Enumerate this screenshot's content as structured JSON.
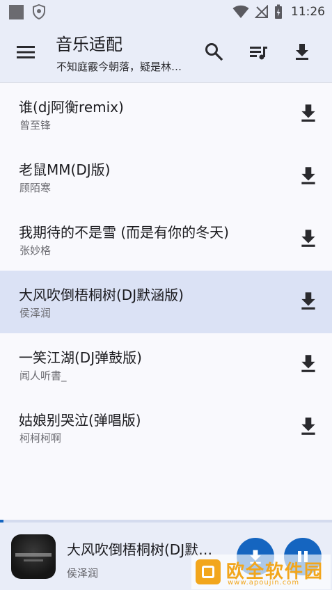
{
  "status_bar": {
    "time": "11:26",
    "icons": [
      "app-square-icon",
      "shield-icon",
      "wifi-icon",
      "no-signal-icon",
      "battery-charging-icon"
    ]
  },
  "app_bar": {
    "title": "音乐适配",
    "subtitle": "不知庭霰今朝落，疑是林…",
    "icons": [
      "menu-icon",
      "search-icon",
      "playlist-icon",
      "download-icon"
    ]
  },
  "songs": [
    {
      "title": "谁(dj阿衡remix)",
      "artist": "曾至锋",
      "selected": false
    },
    {
      "title": "老鼠MM(DJ版)",
      "artist": "顾陌寒",
      "selected": false
    },
    {
      "title": "我期待的不是雪 (而是有你的冬天)",
      "artist": "张妙格",
      "selected": false
    },
    {
      "title": "大风吹倒梧桐树(DJ默涵版)",
      "artist": "侯泽润",
      "selected": true
    },
    {
      "title": "一笑江湖(DJ弹鼓版)",
      "artist": "闻人听書_",
      "selected": false
    },
    {
      "title": "姑娘别哭泣(弹唱版)",
      "artist": "柯柯柯啊",
      "selected": false
    }
  ],
  "player": {
    "title": "大风吹倒梧桐树(DJ默…",
    "artist": "侯泽润",
    "progress_fraction": 0.01,
    "controls": [
      "download-icon",
      "pause-icon"
    ]
  },
  "watermark": {
    "text": "欧全软件园",
    "url": "www.apoujin.com"
  },
  "colors": {
    "accent": "#1565c0",
    "app_bar_bg": "#e9edf8",
    "selected_row_bg": "#dbe2f5",
    "watermark": "#f2a61c"
  }
}
